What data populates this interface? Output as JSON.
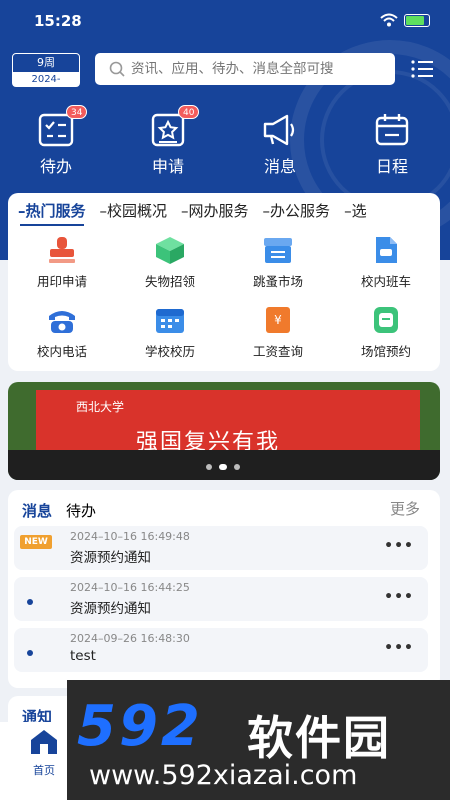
{
  "status": {
    "time": "15:28"
  },
  "week": {
    "label": "9周",
    "year": "2024-"
  },
  "search": {
    "placeholder": "资讯、应用、待办、消息全部可搜"
  },
  "quick": [
    {
      "label": "待办",
      "badge": "34",
      "icon": "checklist-icon"
    },
    {
      "label": "申请",
      "badge": "40",
      "icon": "star-board-icon"
    },
    {
      "label": "消息",
      "badge": "",
      "icon": "megaphone-icon"
    },
    {
      "label": "日程",
      "badge": "",
      "icon": "calendar-icon"
    }
  ],
  "service_tabs": [
    "–热门服务",
    "–校园概况",
    "–网办服务",
    "–办公服务",
    "–选"
  ],
  "services": [
    {
      "label": "用印申请",
      "icon": "stamp-icon",
      "color": "#e8553b"
    },
    {
      "label": "失物招领",
      "icon": "box-icon",
      "color": "#3cc37a"
    },
    {
      "label": "跳蚤市场",
      "icon": "market-icon",
      "color": "#3b8de8"
    },
    {
      "label": "校内班车",
      "icon": "bus-icon",
      "color": "#3b8de8"
    },
    {
      "label": "校内电话",
      "icon": "phone-icon",
      "color": "#2f6fd8"
    },
    {
      "label": "学校校历",
      "icon": "calendar-icon",
      "color": "#3b8de8"
    },
    {
      "label": "工资查询",
      "icon": "salary-icon",
      "color": "#f07a2c"
    },
    {
      "label": "场馆预约",
      "icon": "venue-icon",
      "color": "#3cc37a"
    }
  ],
  "banner": {
    "school": "西北大学",
    "slogan": "强国复兴有我"
  },
  "messages": {
    "tabs": [
      "消息",
      "待办"
    ],
    "more": "更多",
    "items": [
      {
        "time": "2024–10–16 16:49:48",
        "title": "资源预约通知",
        "tag": "NEW"
      },
      {
        "time": "2024–10–16 16:44:25",
        "title": "资源预约通知",
        "tag": ""
      },
      {
        "time": "2024–09–26 16:48:30",
        "title": "test",
        "tag": ""
      }
    ]
  },
  "notice": {
    "title": "通知"
  },
  "nav": {
    "home": "首页"
  },
  "watermark": {
    "logo": "592",
    "cn": "软件园",
    "url": "www.592xiazai.com"
  }
}
